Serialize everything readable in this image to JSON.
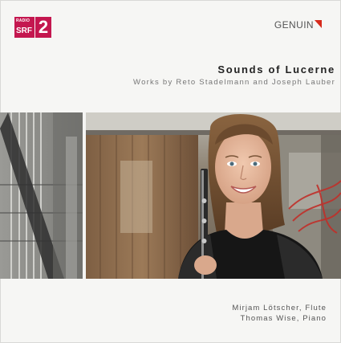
{
  "header": {
    "radio_logo": {
      "radio": "RADIO",
      "srf": "SRF",
      "channel": "2",
      "brand_color": "#c4174f"
    },
    "label_logo": {
      "text": "GENUIN",
      "mark_color": "#d62a1b"
    }
  },
  "album": {
    "title": "Sounds of Lucerne",
    "subtitle": "Works by Reto Stadelmann and Joseph Lauber"
  },
  "performers": [
    {
      "credit": "Mirjam Lötscher, Flute"
    },
    {
      "credit": "Thomas Wise, Piano"
    }
  ],
  "photo": {
    "subject": "woman-holding-flute",
    "colors": {
      "background_gray": "#8a8a86",
      "wood": "#8a6a4c",
      "hair": "#6b4a2e",
      "dress": "#161616",
      "red_accent": "#c0302a"
    }
  }
}
